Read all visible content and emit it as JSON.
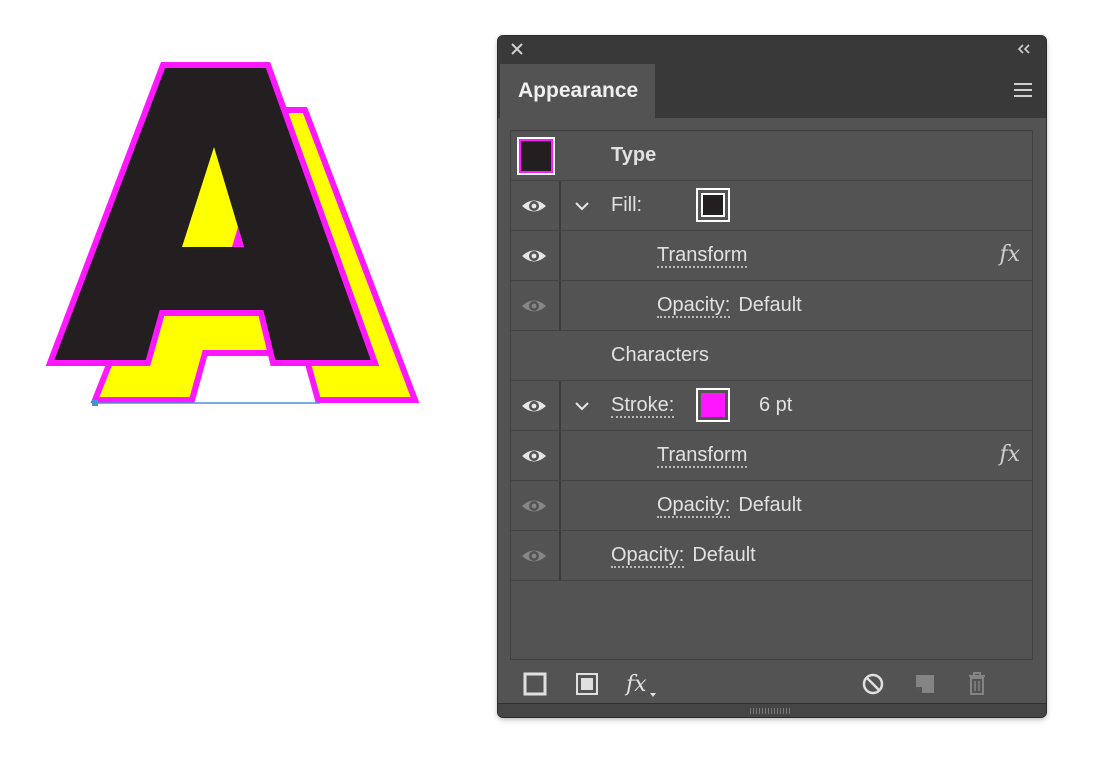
{
  "artwork": {
    "glyph": "A",
    "colors": {
      "fill": "#231f20",
      "stroke": "#ff18ff",
      "shadow": "#ffff00",
      "selection": "#4a90d9"
    }
  },
  "panel": {
    "title": "Appearance",
    "object_type": "Type",
    "rows": {
      "fill_label": "Fill:",
      "fill_transform": "Transform",
      "fill_opacity_label": "Opacity:",
      "fill_opacity_value": "Default",
      "characters": "Characters",
      "stroke_label": "Stroke:",
      "stroke_weight": "6 pt",
      "stroke_transform": "Transform",
      "stroke_opacity_label": "Opacity:",
      "stroke_opacity_value": "Default",
      "opacity_label": "Opacity:",
      "opacity_value": "Default"
    },
    "colors": {
      "fill_swatch": "#231f20",
      "stroke_swatch": "#ff18ff",
      "panel_bg": "#535353"
    }
  }
}
